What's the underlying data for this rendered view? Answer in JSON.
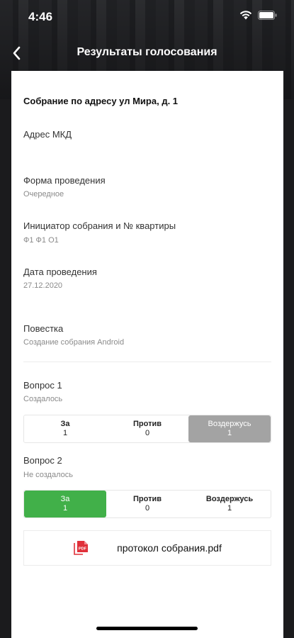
{
  "status_bar": {
    "time": "4:46"
  },
  "nav": {
    "title": "Результаты голосования"
  },
  "meeting": {
    "title": "Собрание по адресу ул Мира, д. 1"
  },
  "fields": {
    "address": {
      "label": "Адрес МКД",
      "value": ""
    },
    "form": {
      "label": "Форма проведения",
      "value": "Очередное"
    },
    "initiator": {
      "label": "Инициатор собрания и № квартиры",
      "value": "Ф1 Ф1 О1"
    },
    "date": {
      "label": "Дата проведения",
      "value": "27.12.2020"
    },
    "agenda": {
      "label": "Повестка",
      "value": "Создание собрания Android"
    }
  },
  "questions": [
    {
      "title": "Вопрос 1",
      "subtitle": "Создалось",
      "options": [
        {
          "label": "За",
          "count": "1"
        },
        {
          "label": "Против",
          "count": "0"
        },
        {
          "label": "Воздержусь",
          "count": "1"
        }
      ]
    },
    {
      "title": "Вопрос 2",
      "subtitle": "Не создалось",
      "options": [
        {
          "label": "За",
          "count": "1"
        },
        {
          "label": "Против",
          "count": "0"
        },
        {
          "label": "Воздержусь",
          "count": "1"
        }
      ]
    }
  ],
  "attachment": {
    "filename": "протокол собрания.pdf",
    "icon": "pdf-icon"
  },
  "colors": {
    "selected_green": "#41b049",
    "selected_gray": "#a3a3a3",
    "pdf_red": "#e0303a"
  }
}
